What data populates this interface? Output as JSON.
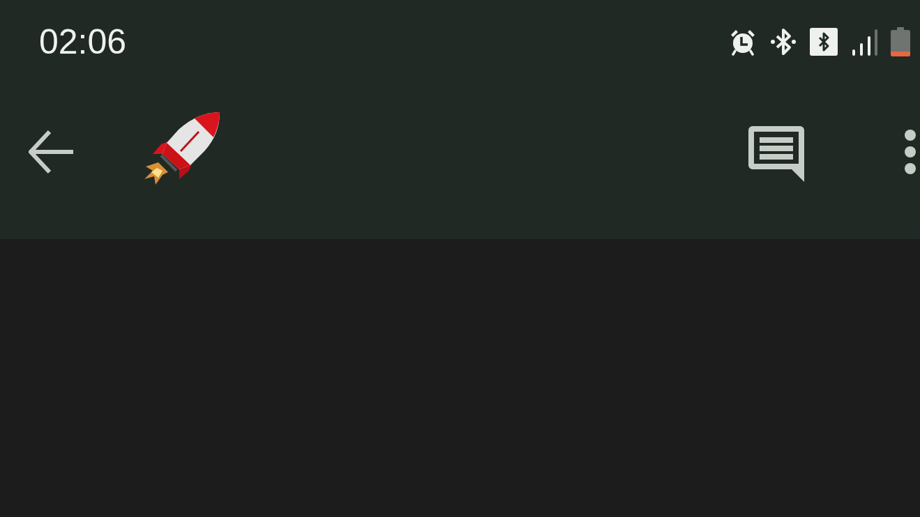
{
  "status_bar": {
    "time": "02:06"
  }
}
